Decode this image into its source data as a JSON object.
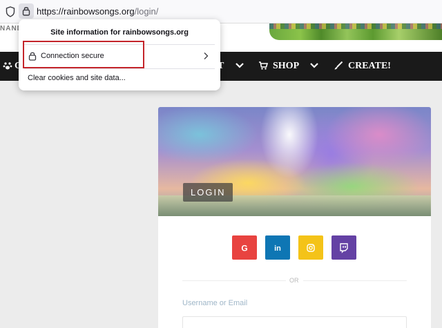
{
  "browser": {
    "url_main": "https://rainbowsongs.org",
    "url_path": "/login/",
    "icons": [
      "shield-icon",
      "lock-icon"
    ]
  },
  "site": {
    "brand_fragment": "NANDI",
    "nav": {
      "item1_fragment": "C",
      "item2_fragment": "T",
      "shop_label": "SHOP",
      "create_label": "CREATE!"
    }
  },
  "popup": {
    "title": "Site information for rainbowsongs.org",
    "connection_label": "Connection secure",
    "clear_label": "Clear cookies and site data...",
    "highlight_color": "#c4242a"
  },
  "login": {
    "hero_label": "LOGIN",
    "social": [
      {
        "name": "google",
        "letter": "G",
        "color": "#e84340"
      },
      {
        "name": "linkedin",
        "letter": "in",
        "color": "#0e76b4"
      },
      {
        "name": "instagram",
        "letter": "",
        "color": "#f4c318"
      },
      {
        "name": "twitch",
        "letter": "",
        "color": "#6441a4"
      }
    ],
    "or_text": "OR",
    "username_label": "Username or Email"
  }
}
